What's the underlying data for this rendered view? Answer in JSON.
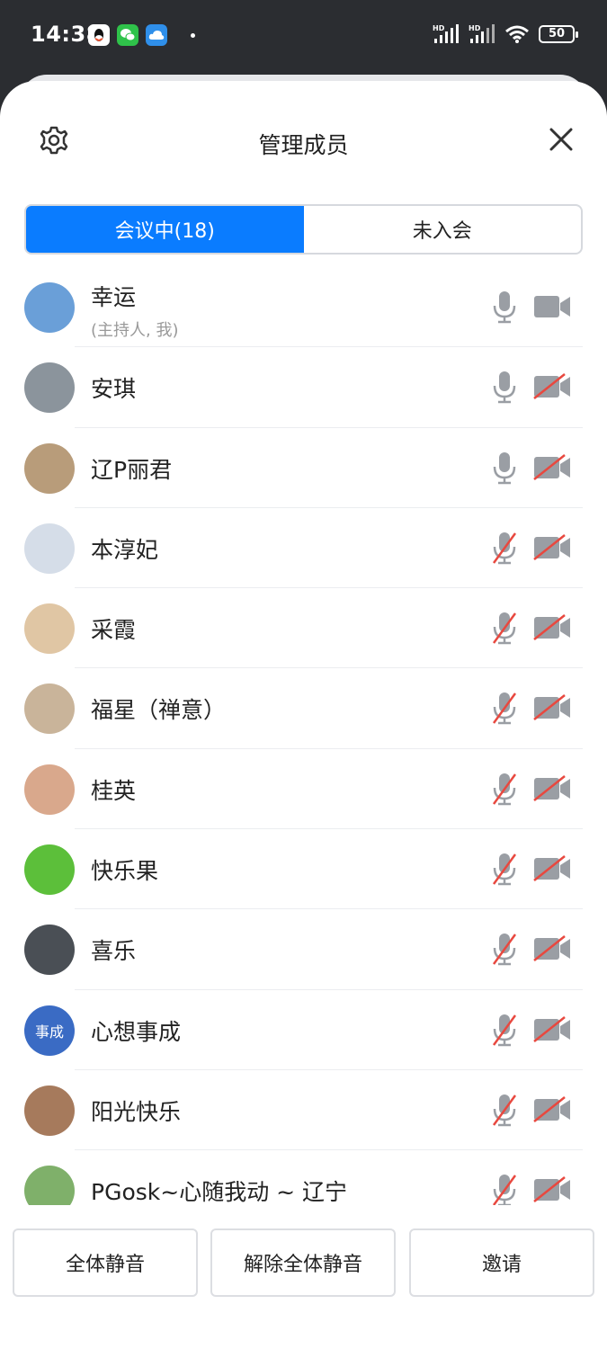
{
  "status_bar": {
    "time": "14:38",
    "app_icons": [
      "qq-icon",
      "wechat-icon",
      "cloud-icon"
    ],
    "network_labels": [
      "HD",
      "HD"
    ],
    "battery": "50"
  },
  "header": {
    "title": "管理成员",
    "settings_icon": "gear-icon",
    "close_icon": "close-icon"
  },
  "tabs": [
    {
      "label": "会议中(18)",
      "active": true
    },
    {
      "label": "未入会",
      "active": false
    }
  ],
  "members": [
    {
      "name": "幸运",
      "role": "(主持人, 我)",
      "mic": "on",
      "camera": "off-plain",
      "avatar_color": "#6a9fd8"
    },
    {
      "name": "安琪",
      "role": "",
      "mic": "on",
      "camera": "muted",
      "avatar_color": "#8b949c"
    },
    {
      "name": "辽P丽君",
      "role": "",
      "mic": "on",
      "camera": "muted",
      "avatar_color": "#b89c7a"
    },
    {
      "name": "本淳妃",
      "role": "",
      "mic": "muted",
      "camera": "muted",
      "avatar_color": "#d5dde8"
    },
    {
      "name": "采霞",
      "role": "",
      "mic": "muted",
      "camera": "muted",
      "avatar_color": "#e0c6a4"
    },
    {
      "name": "福星（禅意）",
      "role": "",
      "mic": "muted",
      "camera": "muted",
      "avatar_color": "#c9b49a"
    },
    {
      "name": "桂英",
      "role": "",
      "mic": "muted",
      "camera": "muted",
      "avatar_color": "#d9a88c"
    },
    {
      "name": "快乐果",
      "role": "",
      "mic": "muted",
      "camera": "muted",
      "avatar_color": "#5cbf3a"
    },
    {
      "name": "喜乐",
      "role": "",
      "mic": "muted",
      "camera": "muted",
      "avatar_color": "#4a4f55"
    },
    {
      "name": "心想事成",
      "role": "",
      "mic": "muted",
      "camera": "muted",
      "avatar_color": "#3a6bc4",
      "avatar_text": "事成"
    },
    {
      "name": "阳光快乐",
      "role": "",
      "mic": "muted",
      "camera": "muted",
      "avatar_color": "#a67a5c"
    },
    {
      "name": "PGosk~心随我动 ~ 辽宁",
      "role": "",
      "mic": "muted",
      "camera": "muted",
      "avatar_color": "#7fb06a"
    }
  ],
  "actions": {
    "mute_all": "全体静音",
    "unmute_all": "解除全体静音",
    "invite": "邀请"
  },
  "colors": {
    "accent": "#0a7cff",
    "icon_gray": "#9a9ea4",
    "muted_red": "#e8483f"
  }
}
